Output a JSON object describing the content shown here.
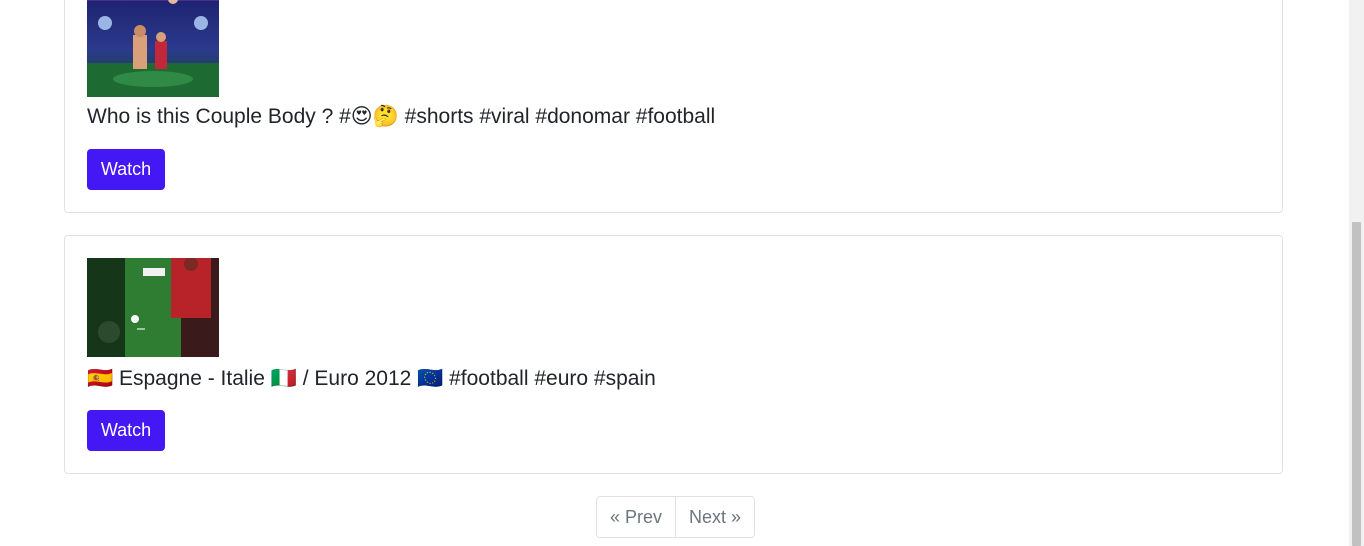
{
  "videos": [
    {
      "title": "Who is this Couple Body ? #😍🤔 #shorts #viral #donomar #football",
      "button_label": "Watch"
    },
    {
      "title": "🇪🇸 Espagne - Italie 🇮🇹 / Euro 2012 🇪🇺 #football #euro #spain",
      "button_label": "Watch"
    }
  ],
  "pagination": {
    "prev_label": "« Prev",
    "next_label": "Next »"
  },
  "colors": {
    "watch_button": "#4318f5",
    "card_border": "#dee2e6",
    "pager_text": "#6c757d"
  }
}
